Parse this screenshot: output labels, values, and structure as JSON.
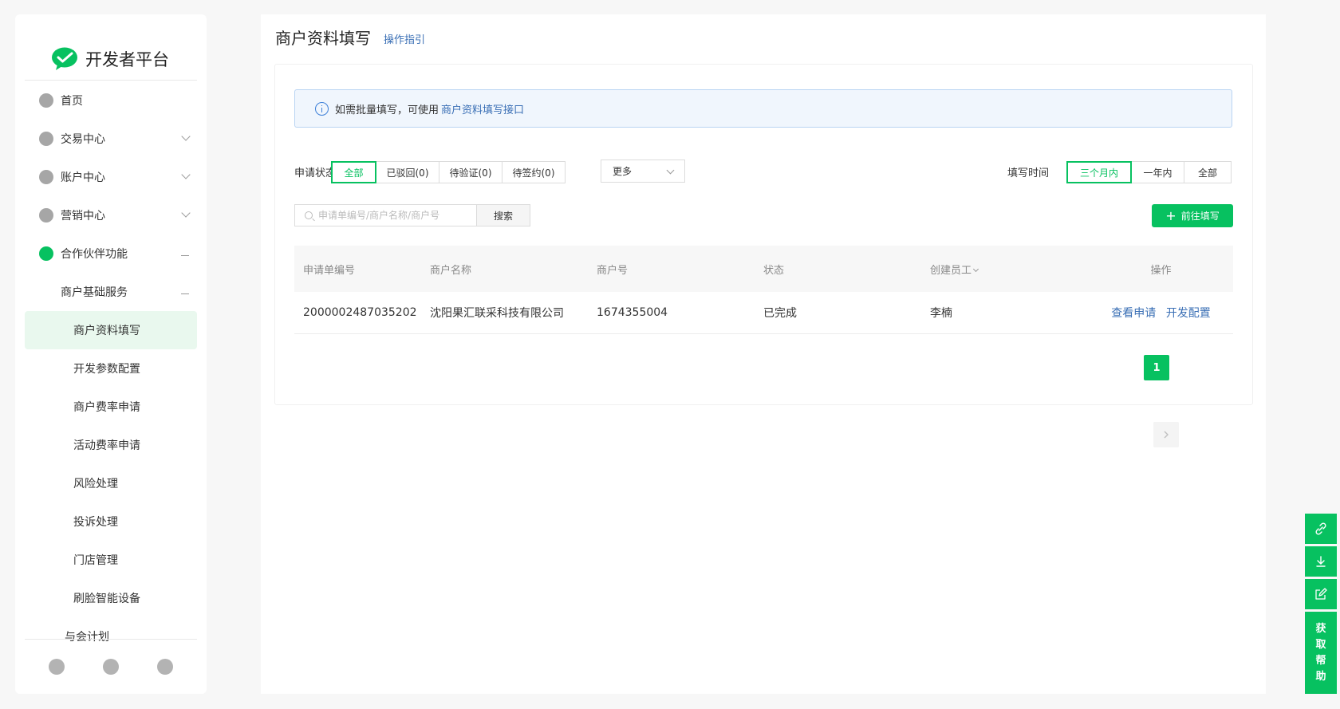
{
  "brand": {
    "name": "开发者平台"
  },
  "sidebar": {
    "items": [
      {
        "label": "首页",
        "marker": "none"
      },
      {
        "label": "交易中心",
        "marker": "chevron"
      },
      {
        "label": "账户中心",
        "marker": "chevron"
      },
      {
        "label": "营销中心",
        "marker": "chevron"
      },
      {
        "label": "合作伙伴功能",
        "marker": "dash",
        "active": true
      }
    ],
    "group": {
      "label": "商户基础服务"
    },
    "sub_items": [
      {
        "label": "商户资料填写",
        "selected": true
      },
      {
        "label": "开发参数配置"
      },
      {
        "label": "商户费率申请"
      },
      {
        "label": "活动费率申请"
      },
      {
        "label": "风险处理"
      },
      {
        "label": "投诉处理"
      },
      {
        "label": "门店管理"
      },
      {
        "label": "刷脸智能设备"
      }
    ],
    "cut_item": "与会计划",
    "footer_icons": [
      "megaphone-icon",
      "bell-icon",
      "user-icon"
    ]
  },
  "header": {
    "title": "商户资料填写",
    "guide_link": "操作指引"
  },
  "notice": {
    "text": "如需批量填写，可使用",
    "link": "商户资料填写接口"
  },
  "filters": {
    "status_label": "申请状态",
    "status_options": [
      "全部",
      "已驳回(0)",
      "待验证(0)",
      "待签约(0)"
    ],
    "more_label": "更多",
    "time_label": "填写时间",
    "time_options": [
      "三个月内",
      "一年内",
      "全部"
    ]
  },
  "search": {
    "placeholder": "申请单编号/商户名称/商户号",
    "button": "搜索"
  },
  "actions": {
    "primary": "前往填写"
  },
  "table": {
    "headers": [
      "申请单编号",
      "商户名称",
      "商户号",
      "状态",
      "创建员工",
      "操作"
    ],
    "rows": [
      {
        "id": "2000002487035202",
        "name": "沈阳果汇联采科技有限公司",
        "merchant_no": "1674355004",
        "status": "已完成",
        "creator": "李楠",
        "actions": [
          "查看申请",
          "开发配置"
        ]
      }
    ]
  },
  "pagination": {
    "current": "1"
  },
  "help": {
    "label": [
      "获",
      "取",
      "帮",
      "助"
    ]
  },
  "colors": {
    "accent": "#07c160",
    "link": "#3a6fb5"
  }
}
